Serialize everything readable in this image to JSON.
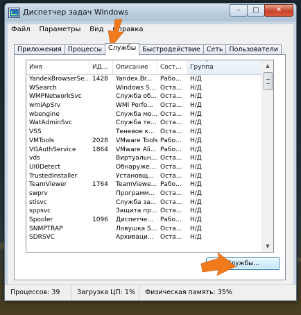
{
  "window": {
    "title": "Диспетчер задач Windows",
    "minimize": "–",
    "maximize": "□",
    "close": "✕"
  },
  "menu": [
    "Файл",
    "Параметры",
    "Вид",
    "Справка"
  ],
  "tabs": [
    "Приложения",
    "Процессы",
    "Службы",
    "Быстродействие",
    "Сеть",
    "Пользователи"
  ],
  "active_tab": "Службы",
  "columns": [
    "Имя",
    "ИД...",
    "Описание",
    "Сост...",
    "Группа"
  ],
  "rows": [
    [
      "YandexBrowserSe...",
      "1428",
      "Yandex.Br...",
      "Рабо...",
      "Н/Д"
    ],
    [
      "WSearch",
      "",
      "Windows S...",
      "Оста...",
      "Н/Д"
    ],
    [
      "WMPNetworkSvc",
      "",
      "Служба об...",
      "Оста...",
      "Н/Д"
    ],
    [
      "wmiApSrv",
      "",
      "WMI Perfo...",
      "Оста...",
      "Н/Д"
    ],
    [
      "wbengine",
      "",
      "Служба мо...",
      "Оста...",
      "Н/Д"
    ],
    [
      "WatAdminSvc",
      "",
      "Служба те...",
      "Оста...",
      "Н/Д"
    ],
    [
      "VSS",
      "",
      "Теневое к...",
      "Оста...",
      "Н/Д"
    ],
    [
      "VMTools",
      "2028",
      "VMware Tools",
      "Рабо...",
      "Н/Д"
    ],
    [
      "VGAuthService",
      "1864",
      "VMware Ali...",
      "Рабо...",
      "Н/Д"
    ],
    [
      "vds",
      "",
      "Виртуальн...",
      "Оста...",
      "Н/Д"
    ],
    [
      "UI0Detect",
      "",
      "Обнаруже...",
      "Оста...",
      "Н/Д"
    ],
    [
      "TrustedInstaller",
      "",
      "Установщ...",
      "Оста...",
      "Н/Д"
    ],
    [
      "TeamViewer",
      "1764",
      "TeamViewe...",
      "Рабо...",
      "Н/Д"
    ],
    [
      "swprv",
      "",
      "Программ...",
      "Оста...",
      "Н/Д"
    ],
    [
      "stisvc",
      "",
      "Служба за...",
      "Оста...",
      "Н/Д"
    ],
    [
      "sppsvc",
      "",
      "Защита пр...",
      "Оста...",
      "Н/Д"
    ],
    [
      "Spooler",
      "1096",
      "Диспетче...",
      "Рабо...",
      "Н/Д"
    ],
    [
      "SNMPTRAP",
      "",
      "Ловушка S...",
      "Оста...",
      "Н/Д"
    ],
    [
      "SDRSVC",
      "",
      "Архиваци...",
      "Оста...",
      "Н/Д"
    ]
  ],
  "scroll": {
    "up": "▲",
    "down": "▼",
    "sort_indicator": "^"
  },
  "services_button": "Службы...",
  "status": {
    "processes": "Процессов: 39",
    "cpu": "Загрузка ЦП: 1%",
    "memory": "Физическая память: 35%"
  },
  "colors": {
    "annotation_arrow": "#f07a1c"
  }
}
